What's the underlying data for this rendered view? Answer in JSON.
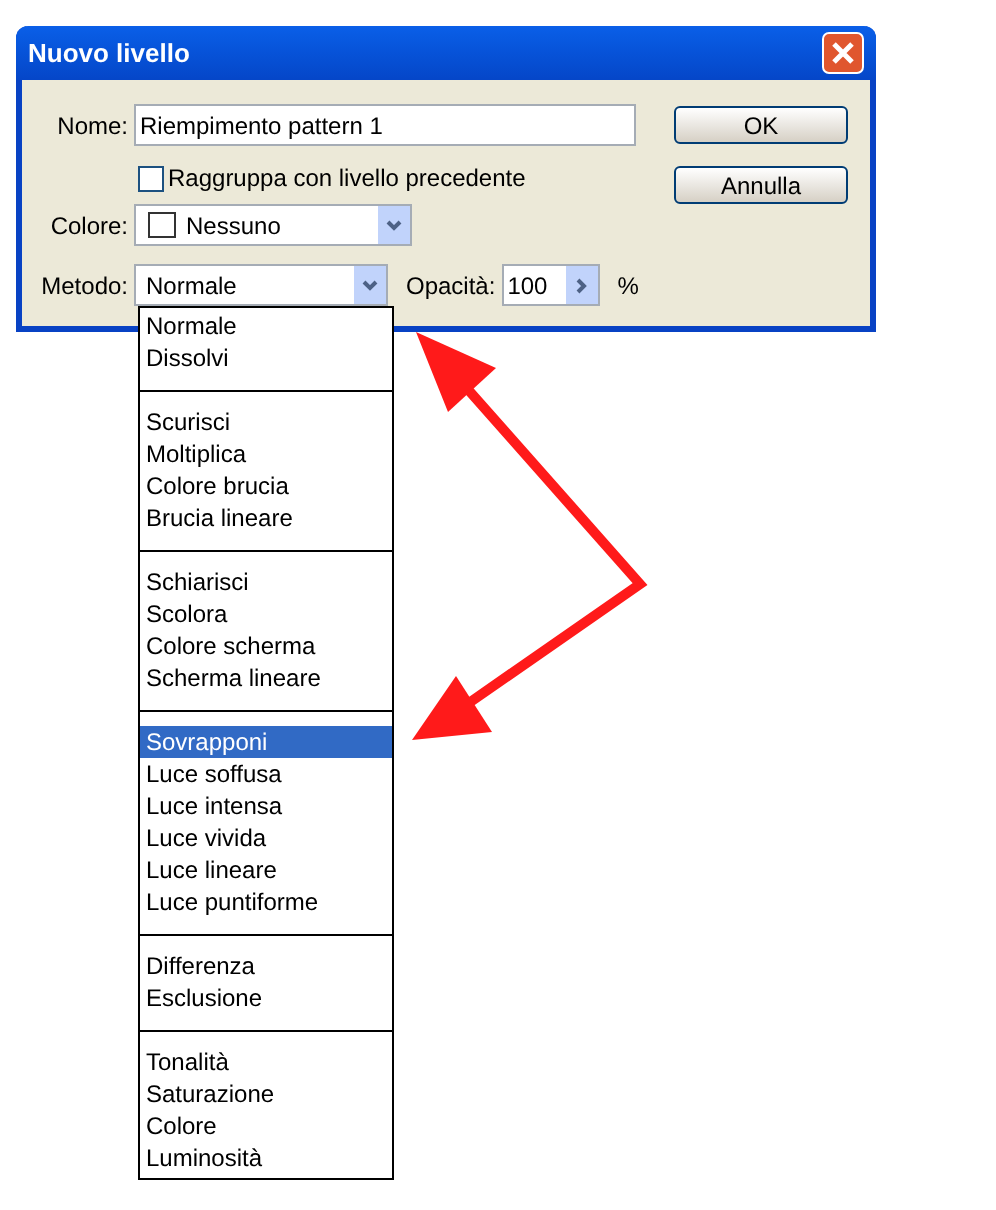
{
  "window": {
    "title": "Nuovo livello"
  },
  "form": {
    "name_label": "Nome:",
    "name_value": "Riempimento pattern 1",
    "group_checkbox": {
      "label": "Raggruppa con livello precedente",
      "checked": false
    },
    "color_label": "Colore:",
    "color_value": "Nessuno",
    "method_label": "Metodo:",
    "method_value": "Normale",
    "opacity_label": "Opacità:",
    "opacity_value": "100",
    "opacity_unit": "%"
  },
  "buttons": [
    "OK",
    "Annulla"
  ],
  "method_list": {
    "groups": [
      {
        "items": [
          {
            "label": "Normale",
            "selected": false
          },
          {
            "label": "Dissolvi",
            "selected": false
          }
        ]
      },
      {
        "items": [
          {
            "label": "Scurisci",
            "selected": false
          },
          {
            "label": "Moltiplica",
            "selected": false
          },
          {
            "label": "Colore brucia",
            "selected": false
          },
          {
            "label": "Brucia lineare",
            "selected": false
          }
        ]
      },
      {
        "items": [
          {
            "label": "Schiarisci",
            "selected": false
          },
          {
            "label": "Scolora",
            "selected": false
          },
          {
            "label": "Colore scherma",
            "selected": false
          },
          {
            "label": "Scherma lineare",
            "selected": false
          }
        ]
      },
      {
        "items": [
          {
            "label": "Sovrapponi",
            "selected": true
          },
          {
            "label": "Luce soffusa",
            "selected": false
          },
          {
            "label": "Luce intensa",
            "selected": false
          },
          {
            "label": "Luce vivida",
            "selected": false
          },
          {
            "label": "Luce lineare",
            "selected": false
          },
          {
            "label": "Luce puntiforme",
            "selected": false
          }
        ]
      },
      {
        "items": [
          {
            "label": "Differenza",
            "selected": false
          },
          {
            "label": "Esclusione",
            "selected": false
          }
        ]
      },
      {
        "items": [
          {
            "label": "Tonalità",
            "selected": false
          },
          {
            "label": "Saturazione",
            "selected": false
          },
          {
            "label": "Colore",
            "selected": false
          },
          {
            "label": "Luminosità",
            "selected": false
          }
        ]
      }
    ]
  }
}
